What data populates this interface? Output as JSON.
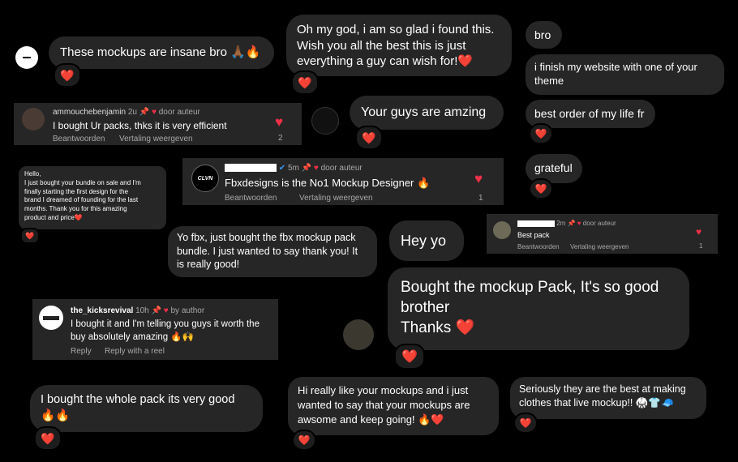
{
  "colors": {
    "bg": "#000000",
    "bubble": "#262626",
    "heart": "#ed2f47",
    "muted": "#a8a8a8",
    "verified": "#3897f0"
  },
  "icons": {
    "heart": "heart-icon",
    "pin": "pin-icon",
    "verified": "verified-badge-icon"
  },
  "b1": {
    "text": "These mockups are insane bro 🙏🏾🔥",
    "reaction": "❤️"
  },
  "b2": {
    "line1": "Oh my god, i am so glad i found this.",
    "line2": "Wish you all the best this is just",
    "line3": "everything a guy can wish for!❤️",
    "reaction": "❤️"
  },
  "b3": {
    "t1": "bro",
    "t2a": "i finish my website with one of your",
    "t2b": "theme",
    "t3": "best order of my life fr",
    "reaction": "❤️"
  },
  "c1": {
    "username": "ammouchebenjamin",
    "time": "2u",
    "tag": "door auteur",
    "text": "I bought Ur packs, thks it is very efficient",
    "reply": "Beantwoorden",
    "translate": "Vertaling weergeven",
    "likes": "2"
  },
  "b4": {
    "text": "Your guys are amzing",
    "reaction": "❤️"
  },
  "b5": {
    "l1": "Hello,",
    "l2": "I just bought your bundle on sale and I'm",
    "l3": "finally starting the first design for the",
    "l4": "brand I dreamed of founding for the last",
    "l5": "months. Thank you for this amazing",
    "l6": "product and price❤️",
    "reaction": "❤️"
  },
  "c2": {
    "time": "5m",
    "tag": "door auteur",
    "text": "Fbxdesigns is the No1 Mockup Designer 🔥",
    "reply": "Beantwoorden",
    "translate": "Vertaling weergeven",
    "likes": "1",
    "avatar_text": "CLVN"
  },
  "b6": {
    "text": "grateful",
    "reaction": "❤️"
  },
  "c3": {
    "time": "2m",
    "tag": "door auteur",
    "text": "Best pack",
    "reply": "Beantwoorden",
    "translate": "Vertaling weergeven",
    "likes": "1"
  },
  "b7": {
    "l1": "Yo fbx, just bought the fbx mockup pack",
    "l2": "bundle. I just wanted to say thank you! It",
    "l3": "is really good!"
  },
  "b8": {
    "text": "Hey yo"
  },
  "b9": {
    "l1": "Bought the mockup Pack, It's so good",
    "l2": "brother",
    "l3": "Thanks ❤️",
    "reaction": "❤️"
  },
  "c4": {
    "username": "the_kicksrevival",
    "time": "10h",
    "tag": "by author",
    "l1": "I bought it and I'm telling you guys it worth the",
    "l2": "buy absolutely amazing 🔥🙌",
    "reply": "Reply",
    "reel": "Reply with a reel"
  },
  "b10": {
    "l1": "I bought the whole pack its very good",
    "l2": "🔥🔥",
    "reaction": "❤️"
  },
  "b11": {
    "l1": "Hi really like your mockups and i just",
    "l2": "wanted to say that your mockups are",
    "l3": "awsome and keep going! 🔥❤️",
    "reaction": "❤️"
  },
  "b12": {
    "l1": "Seriously they are the best at making",
    "l2": "clothes that live mockup!! 🥋👕🧢",
    "reaction": "❤️"
  }
}
